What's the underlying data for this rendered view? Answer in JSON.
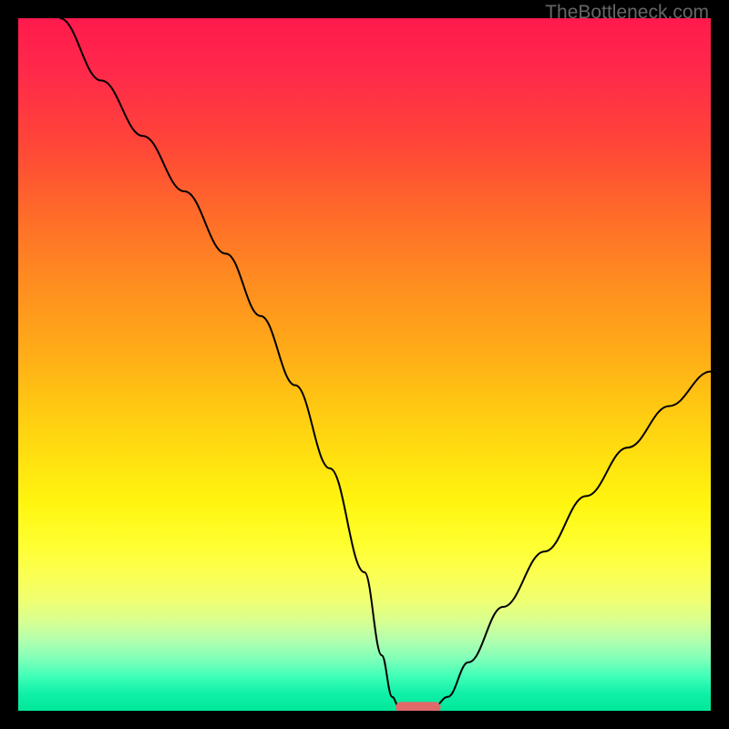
{
  "watermark": "TheBottleneck.com",
  "chart_data": {
    "type": "line",
    "title": "",
    "xlabel": "",
    "ylabel": "",
    "x_range": [
      0,
      100
    ],
    "y_range": [
      0,
      100
    ],
    "series": [
      {
        "name": "curve",
        "x": [
          6,
          12,
          18,
          24,
          30,
          35,
          40,
          45,
          50,
          52.5,
          54,
          55,
          57,
          60,
          62,
          65,
          70,
          76,
          82,
          88,
          94,
          100
        ],
        "y": [
          100,
          91,
          83,
          75,
          66,
          57,
          47,
          35,
          20,
          8,
          2,
          0.5,
          0.5,
          0.5,
          2,
          7,
          15,
          23,
          31,
          38,
          44,
          49
        ]
      }
    ],
    "marker": {
      "name": "optimum-marker",
      "x_start": 54.5,
      "x_end": 61,
      "y": 0.5,
      "color": "#e06a6a"
    },
    "gradient_meaning": "top=red=bad, bottom=green=good"
  }
}
